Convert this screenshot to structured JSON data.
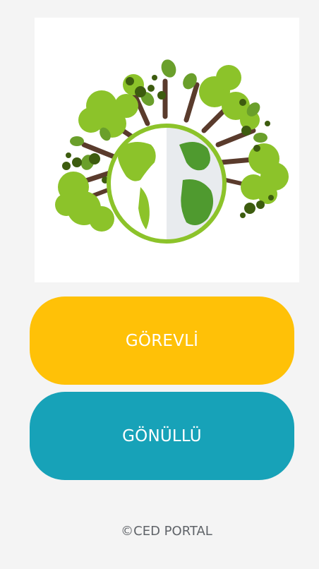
{
  "logo": {
    "icon": "earth-trees-icon"
  },
  "buttons": {
    "officer": {
      "label": "GÖREVLİ",
      "color": "#ffc107"
    },
    "volunteer": {
      "label": "GÖNÜLLÜ",
      "color": "#17a2b8"
    }
  },
  "footer": {
    "text": "©CED PORTAL"
  }
}
